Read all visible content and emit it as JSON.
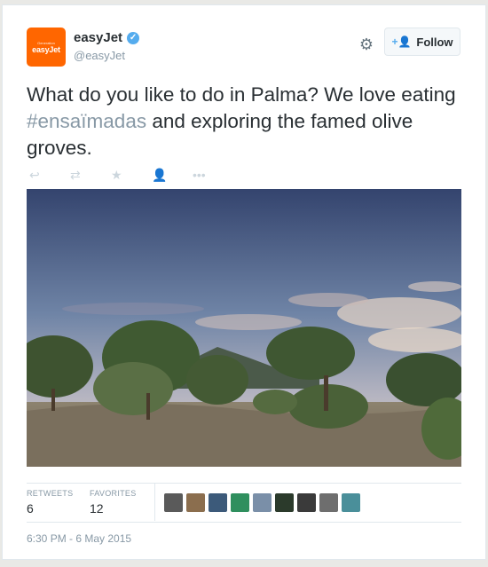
{
  "account": {
    "logo_small": "Generation",
    "logo_brand": "easyJet",
    "name": "easyJet",
    "handle": "@easyJet",
    "verified_mark": "✓"
  },
  "header_actions": {
    "settings_icon": "gear-icon",
    "follow_icon": "+👤",
    "follow_label": "Follow"
  },
  "tweet": {
    "text_before": "What do you like to do in Palma? We love eating ",
    "hashtag": "#ensaïmadas",
    "text_after": " and exploring the famed olive groves."
  },
  "tweet_actions": [
    {
      "name": "reply-icon",
      "glyph": "↩"
    },
    {
      "name": "retweet-icon",
      "glyph": "⇄"
    },
    {
      "name": "favorite-icon",
      "glyph": "★"
    },
    {
      "name": "follow-user-icon",
      "glyph": "👤"
    },
    {
      "name": "more-icon",
      "glyph": "•••"
    }
  ],
  "stats": {
    "retweets_label": "RETWEETS",
    "retweets_value": "6",
    "favorites_label": "FAVORITES",
    "favorites_value": "12"
  },
  "favoriter_avatars": [
    "#5a5a5a",
    "#8b6e4e",
    "#3c5a7a",
    "#2f8f5e",
    "#7a8fa8",
    "#2b3a2b",
    "#3a3a3a",
    "#6e6e6e",
    "#4a8f9a"
  ],
  "timestamp": "6:30 PM - 6 May 2015",
  "colors": {
    "brand_orange": "#ff6600",
    "verified_blue": "#55acee",
    "muted_gray": "#8899a6"
  }
}
